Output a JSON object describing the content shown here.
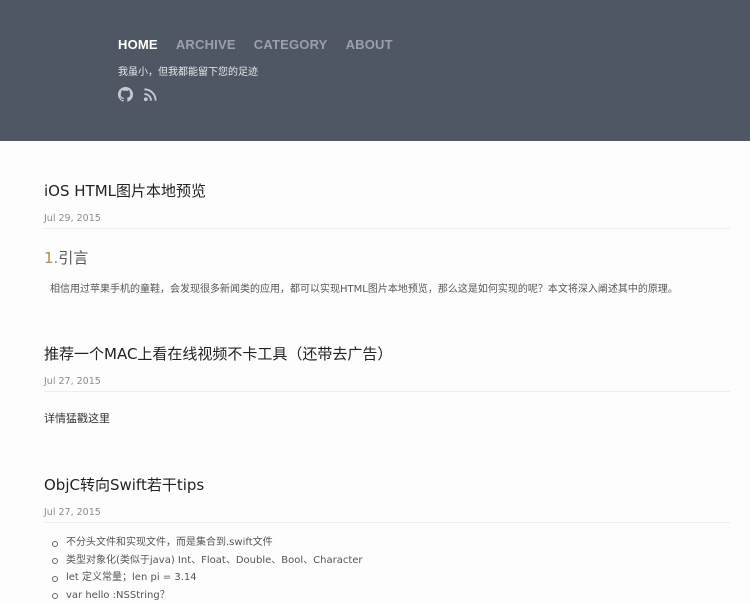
{
  "header": {
    "nav": [
      {
        "label": "HOME",
        "active": true
      },
      {
        "label": "ARCHIVE",
        "active": false
      },
      {
        "label": "CATEGORY",
        "active": false
      },
      {
        "label": "ABOUT",
        "active": false
      }
    ],
    "tagline": "我虽小，但我都能留下您的足迹",
    "social": [
      {
        "icon": "github-icon"
      },
      {
        "icon": "rss-icon"
      }
    ],
    "colors": {
      "background": "#4f5664",
      "nav_active": "#ffffff",
      "nav_inactive": "#9aa1ad"
    }
  },
  "posts": [
    {
      "title": "iOS HTML图片本地预览",
      "date": "Jul 29, 2015",
      "heading_number": "1.",
      "heading_text": "引言",
      "excerpt": "相信用过苹果手机的童鞋，会发现很多新闻类的应用，都可以实现HTML图片本地预览，那么这是如何实现的呢？本文将深入阐述其中的原理。"
    },
    {
      "title": "推荐一个MAC上看在线视频不卡工具（还带去广告）",
      "date": "Jul 27, 2015",
      "text_prefix": "详情猛戳",
      "link_text": "这里"
    },
    {
      "title": "ObjC转向Swift若干tips",
      "date": "Jul 27, 2015",
      "tips": [
        "不分头文件和实现文件，而是集合到.swift文件",
        "类型对象化(类似于java) Int、Float、Double、Bool、Character",
        "let 定义常量；len pi = 3.14",
        "var hello :NSString？"
      ]
    }
  ]
}
